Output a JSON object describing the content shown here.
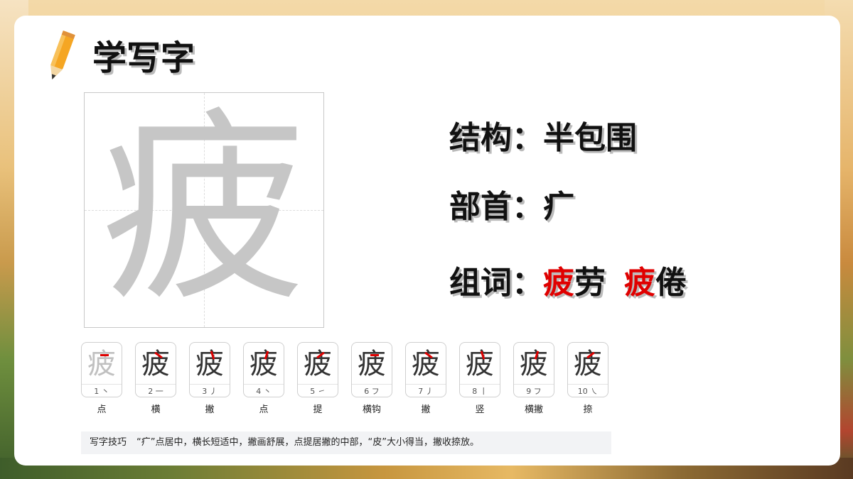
{
  "title": "学写字",
  "character": "疲",
  "structure": {
    "label": "结构：",
    "value": "半包围"
  },
  "radical": {
    "label": "部首：",
    "value": "疒"
  },
  "words": {
    "label": "组词：",
    "items": [
      {
        "highlight": "疲",
        "rest": "劳"
      },
      {
        "highlight": "疲",
        "rest": "倦"
      }
    ]
  },
  "strokes": [
    {
      "number": "1",
      "shape": "丶",
      "name": "点"
    },
    {
      "number": "2",
      "shape": "一",
      "name": "横"
    },
    {
      "number": "3",
      "shape": "丿",
      "name": "撇"
    },
    {
      "number": "4",
      "shape": "丶",
      "name": "点"
    },
    {
      "number": "5",
      "shape": "㇀",
      "name": "提"
    },
    {
      "number": "6",
      "shape": "フ",
      "name": "横钩"
    },
    {
      "number": "7",
      "shape": "丿",
      "name": "撇"
    },
    {
      "number": "8",
      "shape": "丨",
      "name": "竖"
    },
    {
      "number": "9",
      "shape": "フ",
      "name": "横撇"
    },
    {
      "number": "10",
      "shape": "㇏",
      "name": "捺"
    }
  ],
  "tip": {
    "label": "写字技巧",
    "text": "“疒”点居中，横长短适中，撇画舒展，点提居撇的中部，“皮”大小得当，撇收捺放。"
  },
  "colors": {
    "highlight": "#e00000",
    "grid_char": "#c6c6c6"
  }
}
